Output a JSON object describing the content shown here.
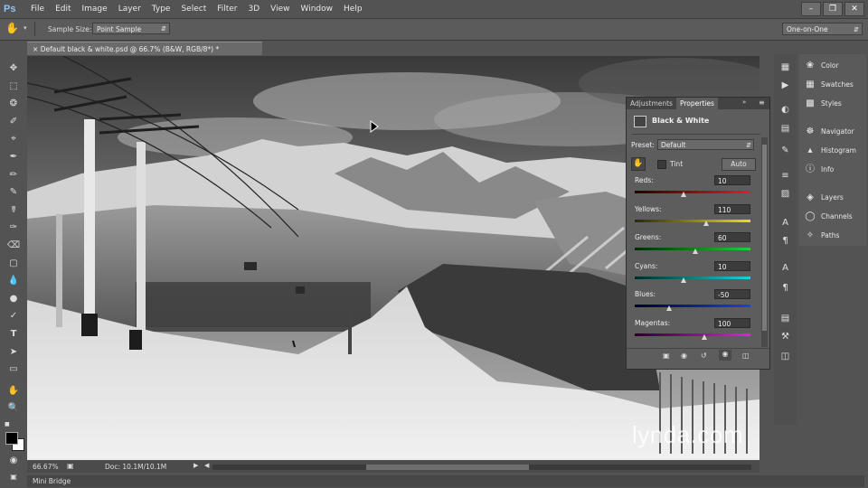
{
  "app": {
    "logo": "Ps"
  },
  "menu": [
    "File",
    "Edit",
    "Image",
    "Layer",
    "Type",
    "Select",
    "Filter",
    "3D",
    "View",
    "Window",
    "Help"
  ],
  "options_bar": {
    "sample_size_label": "Sample Size:",
    "sample_size_value": "Point Sample",
    "workspace": "One-on-One"
  },
  "document_tab": {
    "title": "Default black & white.psd @ 66.7% (B&W, RGB/8*) *",
    "close_glyph": "×"
  },
  "status_bar": {
    "zoom": "66.67%",
    "doc_info": "Doc: 10.1M/10.1M"
  },
  "mini_bridge": {
    "label": "Mini Bridge"
  },
  "collapsed_panels": [
    "Color",
    "Swatches",
    "Styles",
    "Navigator",
    "Histogram",
    "Info",
    "Layers",
    "Channels",
    "Paths"
  ],
  "properties_panel": {
    "tabs": [
      "Adjustments",
      "Properties"
    ],
    "title": "Black & White",
    "preset_label": "Preset:",
    "preset_value": "Default",
    "tint_label": "Tint",
    "auto_label": "Auto",
    "sliders": [
      {
        "label": "Reds:",
        "value": "10",
        "min": -200,
        "max": 300
      },
      {
        "label": "Yellows:",
        "value": "110",
        "min": -200,
        "max": 300
      },
      {
        "label": "Greens:",
        "value": "60",
        "min": -200,
        "max": 300
      },
      {
        "label": "Cyans:",
        "value": "10",
        "min": -200,
        "max": 300
      },
      {
        "label": "Blues:",
        "value": "-50",
        "min": -200,
        "max": 300
      },
      {
        "label": "Magentas:",
        "value": "100",
        "min": -200,
        "max": 300
      }
    ]
  },
  "watermark": "lynda.com",
  "colors": {
    "accent": "#8fc4f4"
  }
}
